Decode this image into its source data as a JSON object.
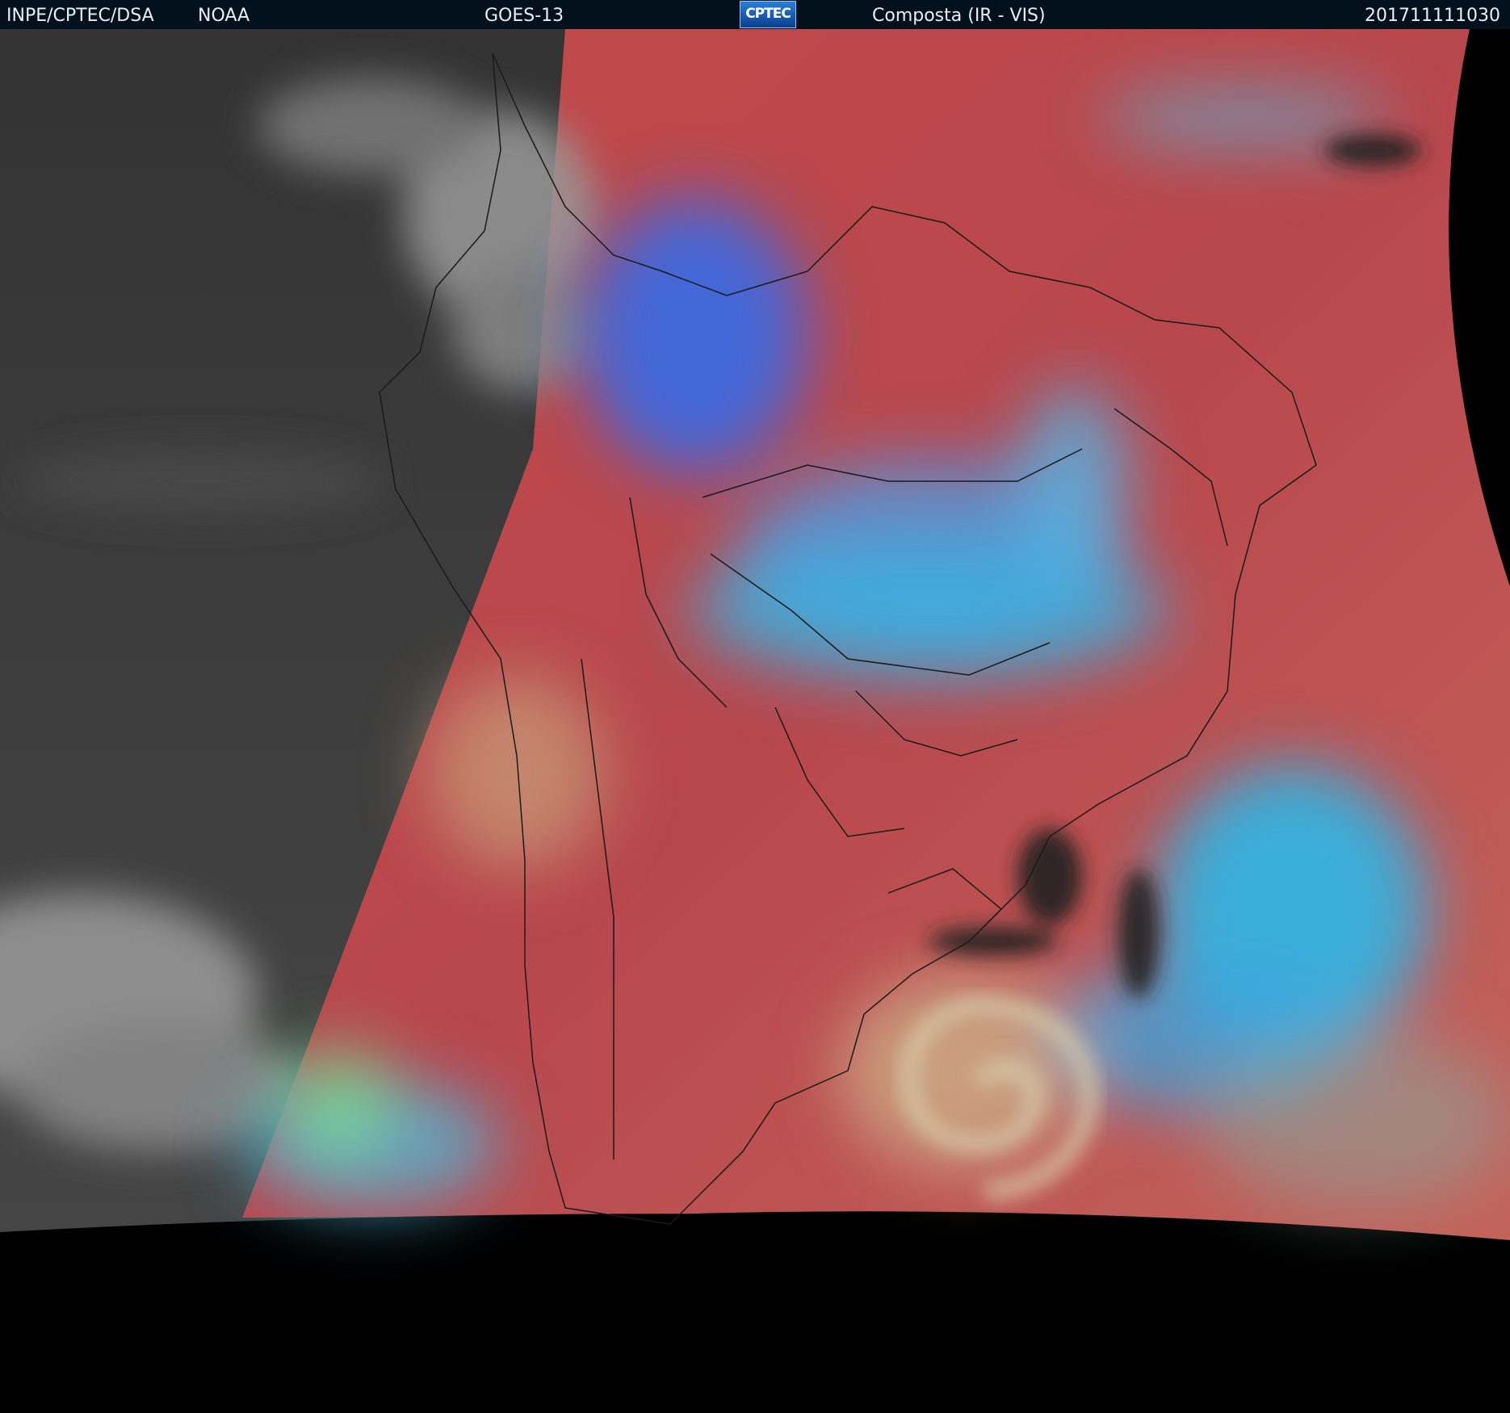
{
  "header": {
    "source": "INPE/CPTEC/DSA",
    "agency": "NOAA",
    "satellite": "GOES-13",
    "logo_text": "CPTEC",
    "product": "Composta (IR - VIS)",
    "timestamp": "201711111030"
  },
  "image": {
    "subject": "satellite composite over South America",
    "colors": {
      "night_ir": "#3b3b3b",
      "day_surface": "#b9484a",
      "cloud_cyan": "#2fb7e8",
      "cloud_blue": "#2f6df0",
      "cloud_green": "#79e08f",
      "space": "#000000"
    }
  }
}
